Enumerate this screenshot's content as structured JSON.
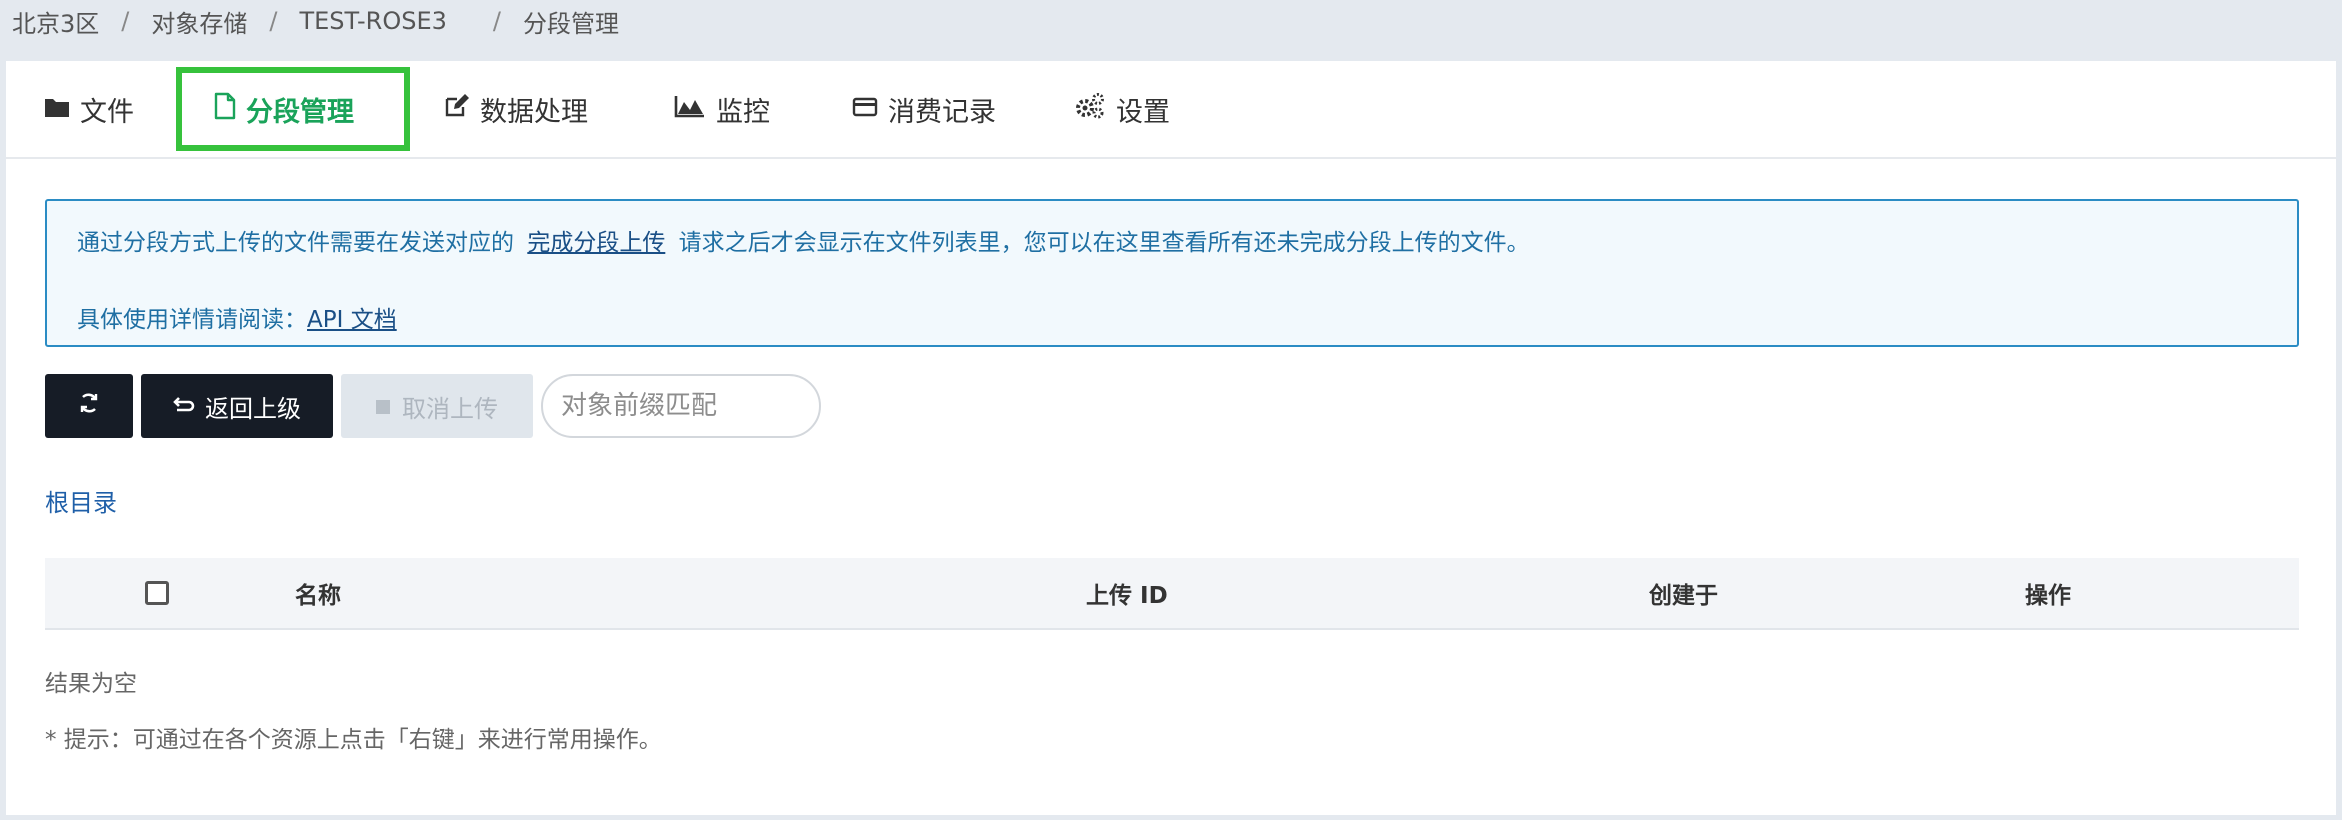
{
  "breadcrumb": {
    "region": "北京3区",
    "service": "对象存储",
    "bucket": "TEST-ROSE3",
    "current": "分段管理"
  },
  "tabs": [
    {
      "label": "文件",
      "icon": "folder-icon"
    },
    {
      "label": "分段管理",
      "icon": "file-icon",
      "active": true
    },
    {
      "label": "数据处理",
      "icon": "edit-icon"
    },
    {
      "label": "监控",
      "icon": "area-chart-icon"
    },
    {
      "label": "消费记录",
      "icon": "credit-card-icon"
    },
    {
      "label": "设置",
      "icon": "gears-icon"
    }
  ],
  "alert": {
    "text_before": "通过分段方式上传的文件需要在发送对应的",
    "link1": "完成分段上传",
    "text_after": "请求之后才会显示在文件列表里，您可以在这里查看所有还未完成分段上传的文件。",
    "read_label": "具体使用详情请阅读：",
    "link2": "API 文档"
  },
  "toolbar": {
    "refresh_icon": "refresh-icon",
    "back_label": "返回上级",
    "cancel_label": "取消上传",
    "search_placeholder": "对象前缀匹配"
  },
  "root_label": "根目录",
  "table": {
    "columns": [
      "名称",
      "上传 ID",
      "创建于",
      "操作"
    ]
  },
  "empty_text": "结果为空",
  "hint_text": "* 提示：可通过在各个资源上点击「右键」来进行常用操作。",
  "colors": {
    "active_tab": "#1aa35a",
    "highlight_border": "#36c23c",
    "alert_border": "#2b8cc4",
    "dark_button": "#161c26"
  }
}
